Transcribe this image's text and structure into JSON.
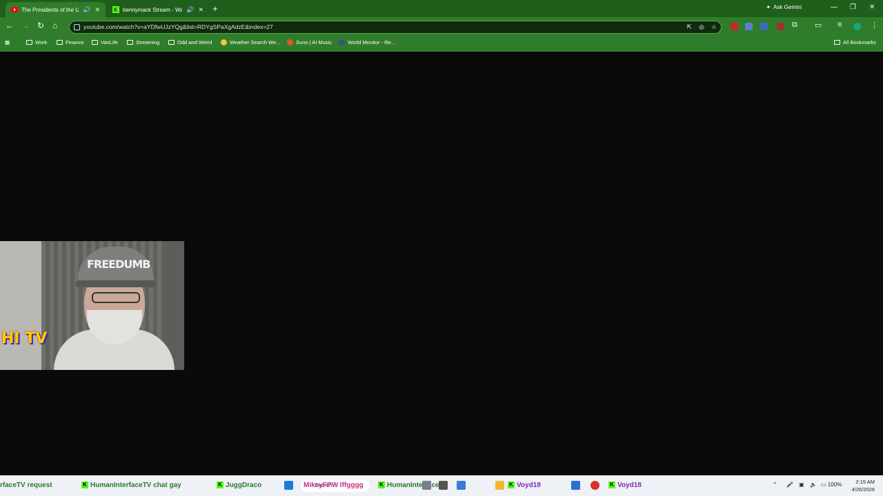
{
  "tabs": [
    {
      "title": "The Presidents of the United States...",
      "active": true
    },
    {
      "title": "bennymack Stream - Watch...",
      "active": false
    }
  ],
  "ask_gemini": "Ask Gemini",
  "address": {
    "url": "youtube.com/watch?v=aYDfwUJzYQg&list=RDYgSPaXgAdzE&index=27"
  },
  "bookmarks": [
    {
      "label": "Work",
      "icon": "folder-icon"
    },
    {
      "label": "Finance",
      "icon": "folder-icon"
    },
    {
      "label": "VanLife",
      "icon": "folder-icon"
    },
    {
      "label": "Streaming",
      "icon": "folder-icon"
    },
    {
      "label": "Odd and Weird",
      "icon": "folder-icon"
    },
    {
      "label": "Weather Search We...",
      "icon": "weather-icon"
    },
    {
      "label": "Suno | AI Music",
      "icon": "suno-icon"
    },
    {
      "label": "World Monitor - Re...",
      "icon": "globe-icon"
    }
  ],
  "all_bookmarks": "All Bookmarks",
  "webcam": {
    "cap_text": "FREEDUMB",
    "logo": "HI TV"
  },
  "taskbar": {
    "ticker": [
      "rfaceTV request",
      "HumanInterfaceTV chat gay",
      "JuggDraco",
      "MikeyFPW lffgggg",
      "HumanInterfaceTV",
      "Voyd18",
      "Voyd18"
    ],
    "search_placeholder": "Search",
    "battery": "100%",
    "time": "2:15 AM",
    "date": "4/26/2026"
  },
  "colors": {
    "chrome": "#2f7d2a",
    "tabstrip": "#1f5f1c",
    "kick": "#53fc18"
  }
}
